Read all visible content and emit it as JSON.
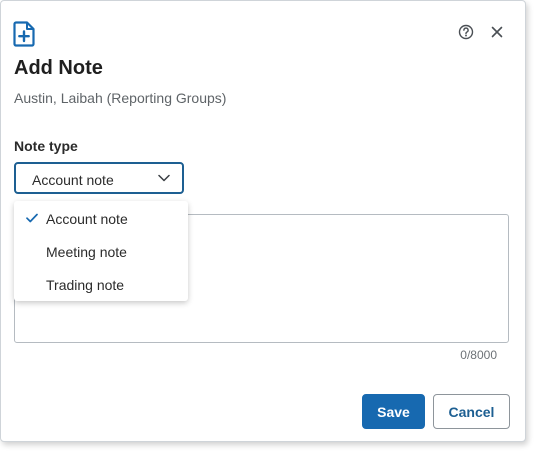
{
  "dialog": {
    "title": "Add Note",
    "subtitle": "Austin, Laibah (Reporting Groups)",
    "header_icons": [
      "document-plus-icon",
      "help-circle-icon",
      "close-icon"
    ]
  },
  "note_type": {
    "label": "Note type",
    "selected": "Account note",
    "options": [
      "Account note",
      "Meeting note",
      "Trading note"
    ]
  },
  "note_text": {
    "value": "",
    "counter": "0/8000"
  },
  "actions": {
    "save_label": "Save",
    "cancel_label": "Cancel"
  },
  "colors": {
    "accent": "#1769b0",
    "focus_border": "#1d5f92"
  }
}
